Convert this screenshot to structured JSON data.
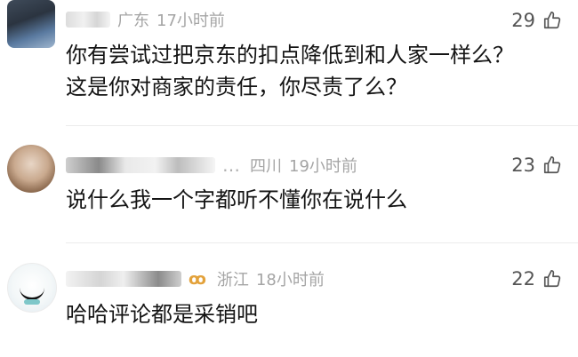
{
  "comments": [
    {
      "location": "广东",
      "time": "17小时前",
      "likes": "29",
      "lines": [
        "你有尝试过把京东的扣点降低到和人家一样么？",
        "这是你对商家的责任，你尽责了么？"
      ]
    },
    {
      "ellipsis": "…",
      "location": "四川",
      "time": "19小时前",
      "likes": "23",
      "lines": [
        "说什么我一个字都听不懂你在说什么"
      ]
    },
    {
      "badge": "ꝏ",
      "location": "浙江",
      "time": "18小时前",
      "likes": "22",
      "lines": [
        "哈哈评论都是采销吧"
      ]
    }
  ],
  "icons": {
    "like": "thumbs-up-outline-icon",
    "badge": "fan-badge-icon"
  },
  "colors": {
    "meta_text": "#a5a5a5",
    "body_text": "#141414",
    "like_count": "#555555",
    "badge": "#e3a23b"
  }
}
